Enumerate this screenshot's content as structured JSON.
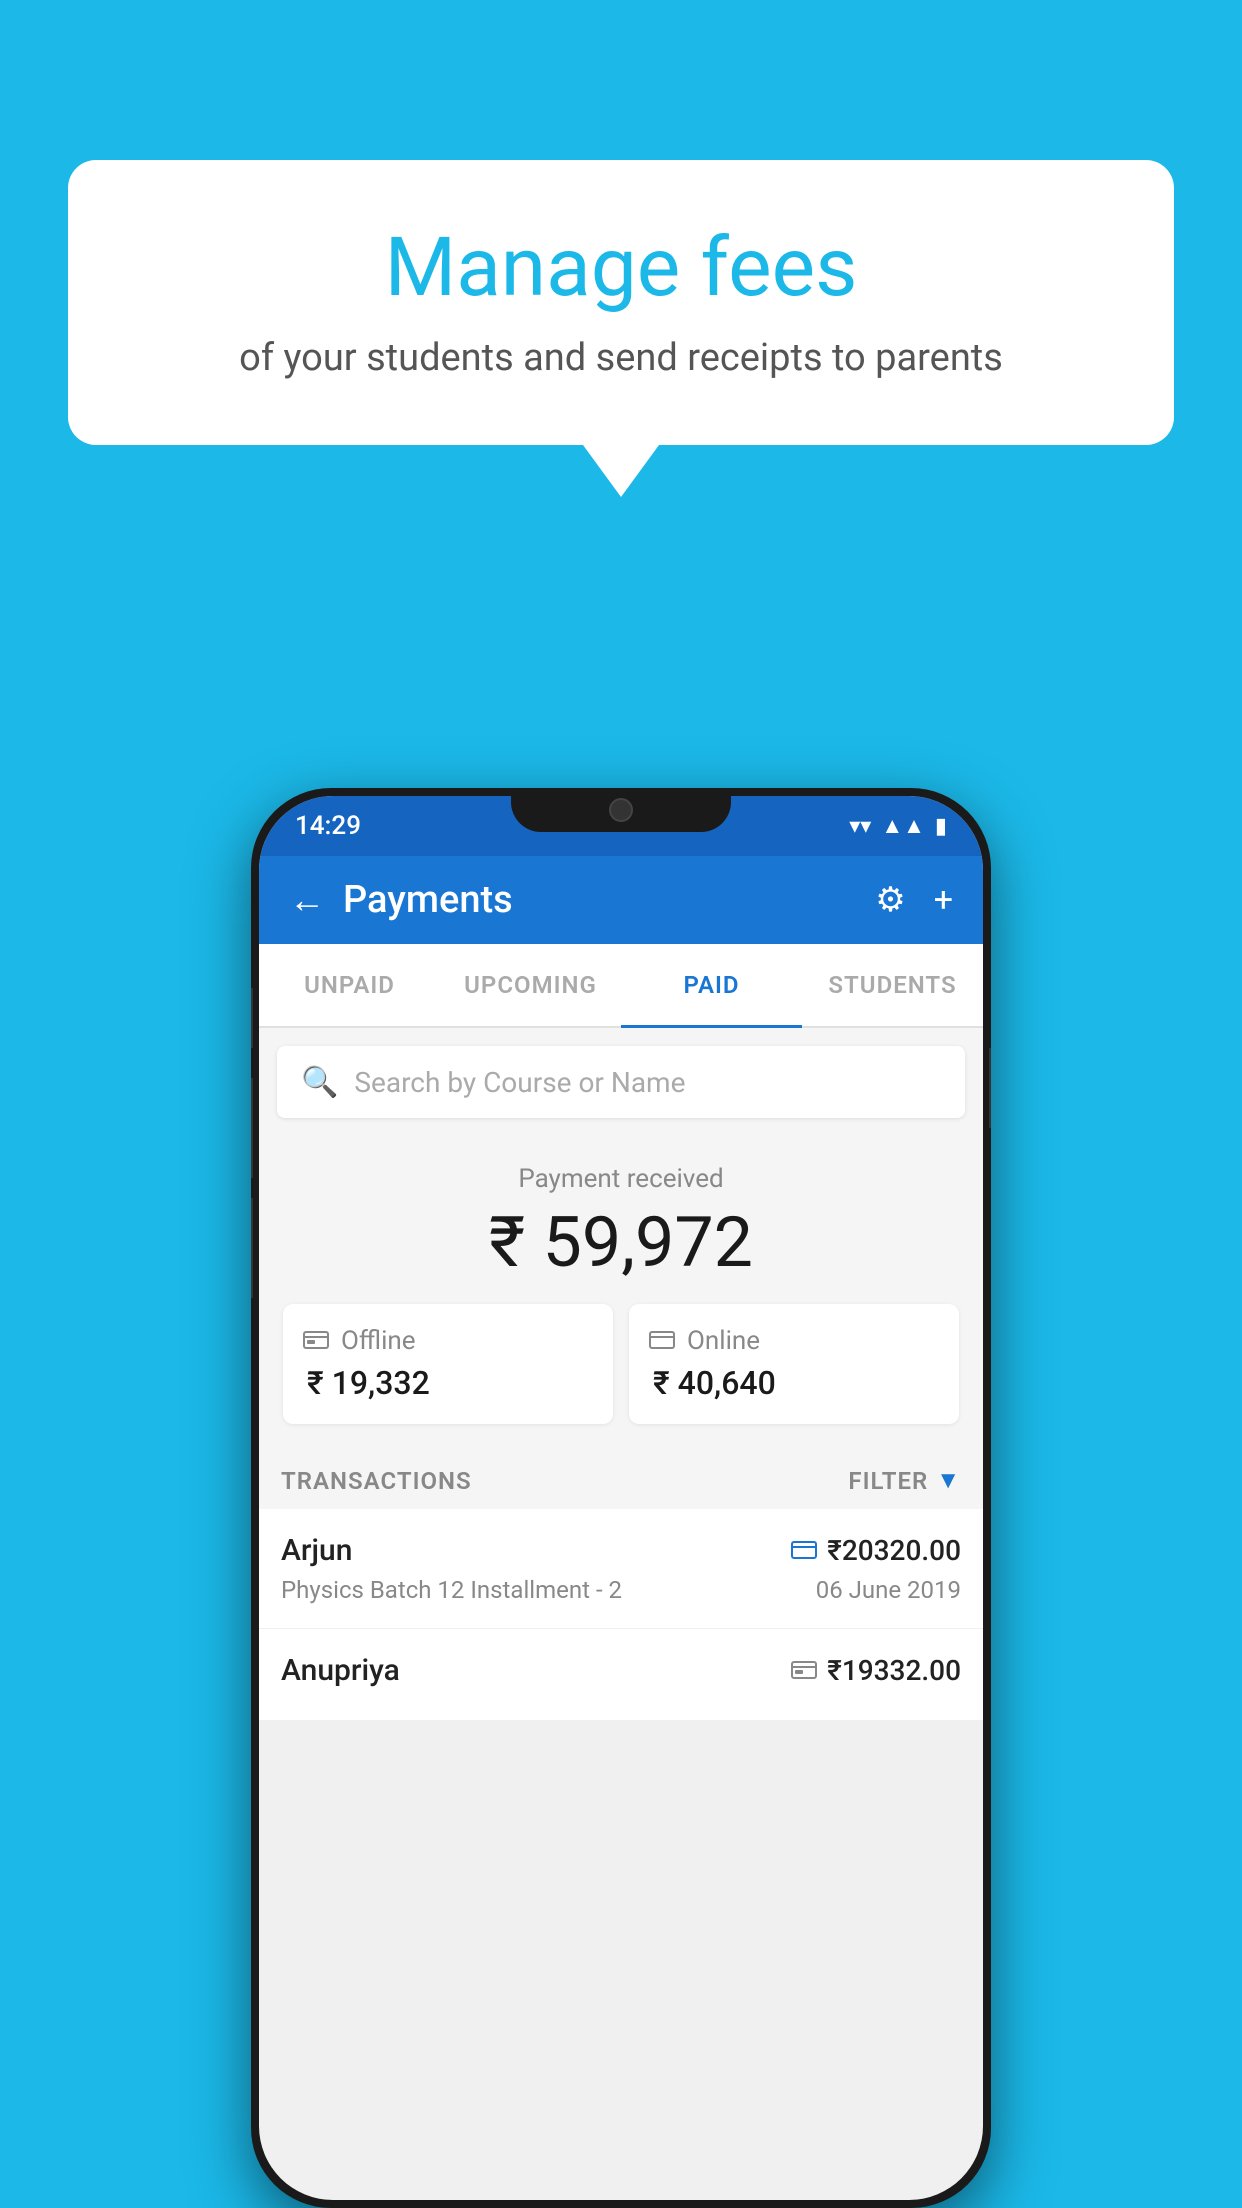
{
  "background_color": "#1BB8E8",
  "speech_bubble": {
    "title": "Manage fees",
    "subtitle": "of your students and send receipts to parents"
  },
  "status_bar": {
    "time": "14:29",
    "wifi_icon": "wifi",
    "signal_icon": "signal",
    "battery_icon": "battery"
  },
  "app_header": {
    "title": "Payments",
    "back_label": "←",
    "settings_icon": "⚙",
    "add_icon": "+"
  },
  "tabs": [
    {
      "label": "UNPAID",
      "active": false
    },
    {
      "label": "UPCOMING",
      "active": false
    },
    {
      "label": "PAID",
      "active": true
    },
    {
      "label": "STUDENTS",
      "active": false
    }
  ],
  "search": {
    "placeholder": "Search by Course or Name"
  },
  "payment_summary": {
    "label": "Payment received",
    "amount": "₹ 59,972",
    "offline": {
      "label": "Offline",
      "amount": "₹ 19,332"
    },
    "online": {
      "label": "Online",
      "amount": "₹ 40,640"
    }
  },
  "transactions": {
    "label": "TRANSACTIONS",
    "filter_label": "FILTER",
    "items": [
      {
        "name": "Arjun",
        "course": "Physics Batch 12 Installment - 2",
        "amount": "₹20320.00",
        "date": "06 June 2019",
        "payment_type": "online"
      },
      {
        "name": "Anupriya",
        "course": "",
        "amount": "₹19332.00",
        "date": "",
        "payment_type": "offline"
      }
    ]
  }
}
